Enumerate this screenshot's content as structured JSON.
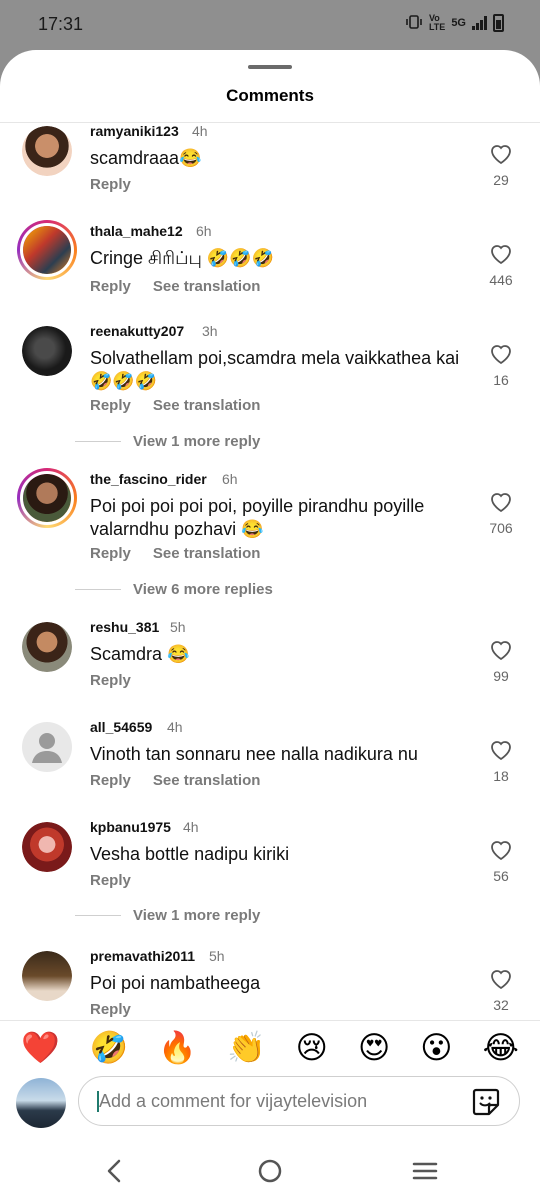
{
  "status_bar": {
    "time": "17:31",
    "network": "5G"
  },
  "sheet": {
    "title": "Comments"
  },
  "comments": [
    {
      "username": "ramyaniki123",
      "time": "4h",
      "text": "scamdraaa😂",
      "reply": "Reply",
      "likes": "29"
    },
    {
      "username": "thala_mahe12",
      "time": "6h",
      "text": "Cringe சிரிப்பு 🤣🤣🤣",
      "reply": "Reply",
      "translate": "See translation",
      "likes": "446"
    },
    {
      "username": "reenakutty207",
      "time": "3h",
      "text": "Solvathellam poi,scamdra mela vaikkathea kai 🤣🤣🤣",
      "reply": "Reply",
      "translate": "See translation",
      "likes": "16",
      "view_more": "View 1 more reply"
    },
    {
      "username": "the_fascino_rider",
      "time": "6h",
      "text": "Poi poi poi poi poi, poyille pirandhu poyille valarndhu pozhavi 😂",
      "reply": "Reply",
      "translate": "See translation",
      "likes": "706",
      "view_more": "View 6 more replies"
    },
    {
      "username": "reshu_381",
      "time": "5h",
      "text": "Scamdra 😂",
      "reply": "Reply",
      "likes": "99"
    },
    {
      "username": "all_54659",
      "time": "4h",
      "text": "Vinoth tan sonnaru nee nalla nadikura nu",
      "reply": "Reply",
      "translate": "See translation",
      "likes": "18"
    },
    {
      "username": "kpbanu1975",
      "time": "4h",
      "text": "Vesha bottle nadipu kiriki",
      "reply": "Reply",
      "likes": "56",
      "view_more": "View 1 more reply"
    },
    {
      "username": "premavathi2011",
      "time": "5h",
      "text": "Poi poi nambatheega",
      "reply": "Reply",
      "likes": "32"
    }
  ],
  "reactions": [
    "❤️",
    "🤣",
    "🔥",
    "👏",
    "😢",
    "😍",
    "😮",
    "😂"
  ],
  "compose": {
    "placeholder": "Add a comment for vijaytelevision"
  },
  "colors": {
    "accent_ring": "#d62976",
    "heart": "#e0245e",
    "muted": "#7a7a7a"
  }
}
